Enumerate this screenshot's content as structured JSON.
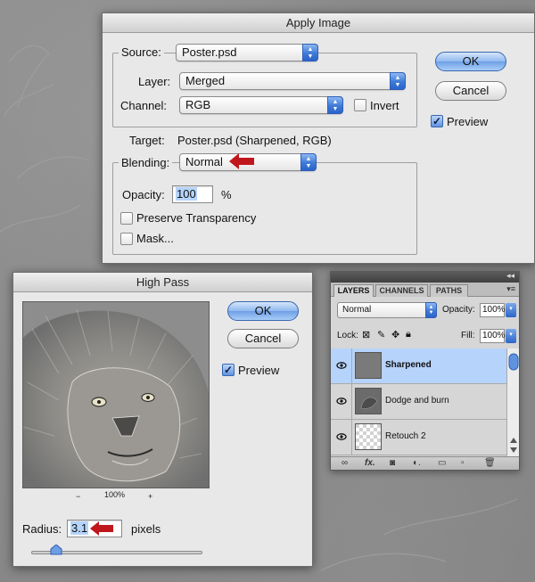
{
  "apply_image": {
    "title": "Apply Image",
    "source_label": "Source:",
    "source_value": "Poster.psd",
    "layer_label": "Layer:",
    "layer_value": "Merged",
    "channel_label": "Channel:",
    "channel_value": "RGB",
    "invert_label": "Invert",
    "invert_checked": false,
    "target_label": "Target:",
    "target_value": "Poster.psd (Sharpened, RGB)",
    "blending_label": "Blending:",
    "blending_value": "Normal",
    "opacity_label": "Opacity:",
    "opacity_value": "100",
    "opacity_unit": "%",
    "preserve_transparency_label": "Preserve Transparency",
    "preserve_transparency_checked": false,
    "mask_label": "Mask...",
    "mask_checked": false,
    "ok_label": "OK",
    "cancel_label": "Cancel",
    "preview_label": "Preview",
    "preview_checked": true
  },
  "high_pass": {
    "title": "High Pass",
    "zoom_minus": "−",
    "zoom_level": "100%",
    "zoom_plus": "+",
    "ok_label": "OK",
    "cancel_label": "Cancel",
    "preview_label": "Preview",
    "preview_checked": true,
    "radius_label": "Radius:",
    "radius_value": "3.1",
    "radius_unit": "pixels"
  },
  "layers_panel": {
    "tabs": [
      "LAYERS",
      "CHANNELS",
      "PATHS"
    ],
    "active_tab": "LAYERS",
    "blend_mode": "Normal",
    "opacity_label": "Opacity:",
    "opacity_value": "100%",
    "lock_label": "Lock:",
    "fill_label": "Fill:",
    "fill_value": "100%",
    "layers": [
      {
        "name": "Sharpened",
        "selected": true,
        "visible": true
      },
      {
        "name": "Dodge and burn",
        "selected": false,
        "visible": true
      },
      {
        "name": "Retouch 2",
        "selected": false,
        "visible": true
      }
    ],
    "bottom_icons": [
      "link-icon",
      "fx-icon",
      "mask-icon",
      "adjustment-icon",
      "group-icon",
      "new-layer-icon",
      "trash-icon"
    ]
  },
  "colors": {
    "accent_blue": "#6e9fe6",
    "annotation_red": "#c0171c",
    "selection_blue": "#b6d3fb"
  }
}
